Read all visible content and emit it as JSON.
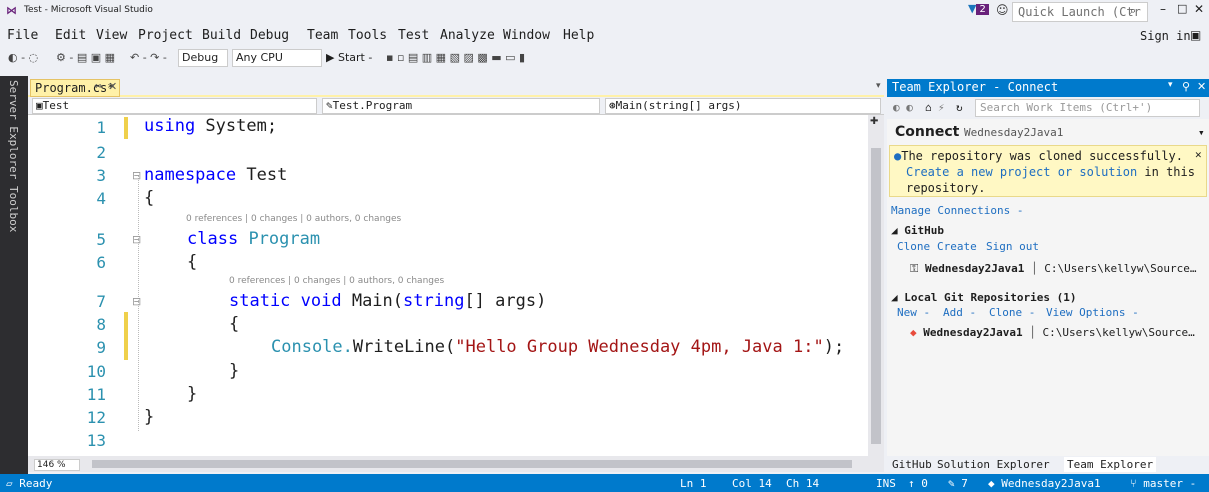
{
  "window": {
    "title": "Test - Microsoft Visual Studio",
    "notification_count": "2",
    "quick_launch_placeholder": "Quick Launch (Ctr",
    "sign_in": "Sign in"
  },
  "menu": [
    "File",
    "Edit",
    "View",
    "Project",
    "Build",
    "Debug",
    "Team",
    "Tools",
    "Test",
    "Analyze",
    "Window",
    "Help"
  ],
  "toolbar": {
    "config": "Debug",
    "platform": "Any CPU",
    "start": "▶ Start -"
  },
  "side_tabs": [
    "Server Explorer",
    "Toolbox"
  ],
  "editor": {
    "tab_label": "Program.cs*",
    "nav_project": "Test",
    "nav_class": "Test.Program",
    "nav_member": "Main(string[] args)",
    "zoom": "146 %",
    "line_numbers": [
      "1",
      "2",
      "3",
      "4",
      "5",
      "6",
      "7",
      "8",
      "9",
      "10",
      "11",
      "12",
      "13"
    ],
    "code": {
      "l1_kw": "using",
      "l1_rest": " System;",
      "l3_kw": "namespace",
      "l3_rest": " Test",
      "l4": "{",
      "l5_kw": "class",
      "l5_ty": "Program",
      "l6": "{",
      "l7_kw": "static void",
      "l7_name": " Main(",
      "l7_ty": "string",
      "l7_rest": "[] args)",
      "l8": "{",
      "l9_obj": "Console.",
      "l9_method": "WriteLine(",
      "l9_str": "\"Hello Group Wednesday 4pm, Java 1:\"",
      "l9_end": ");",
      "l10": "}",
      "l11": "}",
      "l12": "}"
    },
    "codelens_class": "0 references | 0 changes | 0 authors, 0 changes",
    "codelens_main": "0 references | 0 changes | 0 authors, 0 changes"
  },
  "team_explorer": {
    "title": "Team Explorer - Connect",
    "search_placeholder": "Search Work Items (Ctrl+')",
    "heading": "Connect",
    "heading_repo": "Wednesday2Java1",
    "info_line1": "The repository was cloned successfully.",
    "info_link": "Create a new project or solution",
    "info_tail": " in this",
    "info_line3": "repository.",
    "manage": "Manage Connections -",
    "github_header": "GitHub",
    "github_links": [
      "Clone",
      "Create",
      "Sign out"
    ],
    "github_repo": "Wednesday2Java1",
    "github_path": "C:\\Users\\kellyw\\Source…",
    "local_header": "Local Git Repositories (1)",
    "local_actions": [
      "New -",
      "Add -",
      "Clone -",
      "View Options -"
    ],
    "local_repo": "Wednesday2Java1",
    "local_path": "C:\\Users\\kellyw\\Source…",
    "bottom_tabs": [
      "GitHub",
      "Solution Explorer",
      "Team Explorer"
    ]
  },
  "status": {
    "ready": "Ready",
    "ln": "Ln 1",
    "col": "Col 14",
    "ch": "Ch 14",
    "ins": "INS",
    "up": "↑ 0",
    "edits": "✎ 7",
    "repo": "◆ Wednesday2Java1",
    "branch": "⑂ master -"
  },
  "colors": {
    "accent": "#007acc",
    "keyword": "#0000ff",
    "type": "#2b91af",
    "string": "#a31515"
  }
}
